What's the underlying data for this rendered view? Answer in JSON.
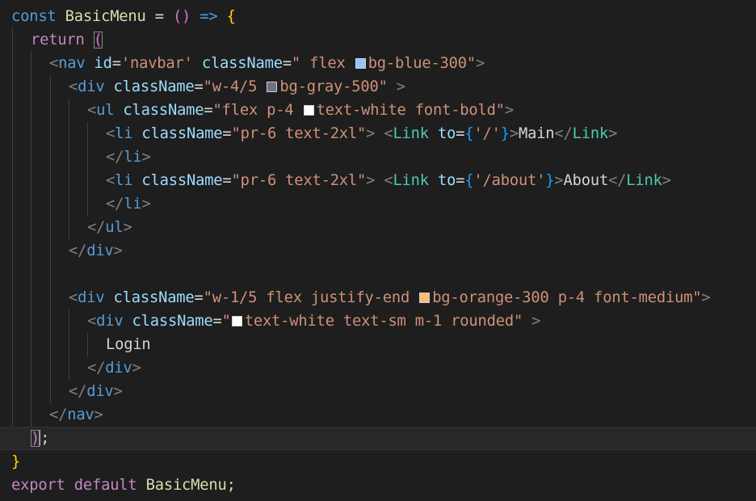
{
  "editor": {
    "colors": {
      "background": "#1e1e1e",
      "keyword": "#569cd6",
      "control": "#c586c0",
      "function": "#dcdcaa",
      "component": "#4ec9b0",
      "attribute": "#9cdcfe",
      "string": "#ce9178",
      "brace": "#ffd700",
      "swatch_blue_300": "#93c5fd",
      "swatch_gray_500": "#6b7280",
      "swatch_white": "#ffffff",
      "swatch_orange_300": "#fdba74"
    },
    "lines": [
      {
        "t1": "const ",
        "t2": "BasicMenu",
        "t3": " = ",
        "t4": "()",
        "t5": " => ",
        "t6": "{"
      },
      {
        "t1": "return ",
        "t2": "("
      },
      {
        "t1": "<",
        "t2": "nav",
        "t3": " id",
        "t4": "=",
        "t5": "'navbar'",
        "t6": " className",
        "t7": "=",
        "t8": "\" flex ",
        "t9": "bg-blue-300\"",
        "t10": ">"
      },
      {
        "t1": "<",
        "t2": "div",
        "t3": " className",
        "t4": "=",
        "t5": "\"w-4/5 ",
        "t6": "bg-gray-500\"",
        "t7": " >"
      },
      {
        "t1": "<",
        "t2": "ul",
        "t3": " className",
        "t4": "=",
        "t5": "\"flex p-4 ",
        "t6": "text-white font-bold\"",
        "t7": ">"
      },
      {
        "t1": "<",
        "t2": "li",
        "t3": " className",
        "t4": "=",
        "t5": "\"pr-6 text-2xl\"",
        "t6": "> <",
        "t7": "Link",
        "t8": " to",
        "t9": "=",
        "t10": "{",
        "t11": "'/'",
        "t12": "}",
        "t13": ">",
        "t14": "Main",
        "t15": "</",
        "t16": "Link",
        "t17": ">"
      },
      {
        "t1": "</",
        "t2": "li",
        "t3": ">"
      },
      {
        "t1": "<",
        "t2": "li",
        "t3": " className",
        "t4": "=",
        "t5": "\"pr-6 text-2xl\"",
        "t6": "> <",
        "t7": "Link",
        "t8": " to",
        "t9": "=",
        "t10": "{",
        "t11": "'/about'",
        "t12": "}",
        "t13": ">",
        "t14": "About",
        "t15": "</",
        "t16": "Link",
        "t17": ">"
      },
      {
        "t1": "</",
        "t2": "li",
        "t3": ">"
      },
      {
        "t1": "</",
        "t2": "ul",
        "t3": ">"
      },
      {
        "t1": "</",
        "t2": "div",
        "t3": ">"
      },
      {},
      {
        "t1": "<",
        "t2": "div",
        "t3": " className",
        "t4": "=",
        "t5": "\"w-1/5 flex justify-end ",
        "t6": "bg-orange-300 p-4 font-medium\"",
        "t7": ">"
      },
      {
        "t1": "<",
        "t2": "div",
        "t3": " className",
        "t4": "=",
        "t5": "\"",
        "t6": "text-white text-sm m-1 rounded\"",
        "t7": " >"
      },
      {
        "t1": "Login"
      },
      {
        "t1": "</",
        "t2": "div",
        "t3": ">"
      },
      {
        "t1": "</",
        "t2": "div",
        "t3": ">"
      },
      {
        "t1": "</",
        "t2": "nav",
        "t3": ">"
      },
      {
        "t1": ")",
        "t2": ";"
      },
      {
        "t1": "}"
      },
      {
        "t1": "export ",
        "t2": "default ",
        "t3": "BasicMenu",
        "t4": ";"
      }
    ]
  }
}
